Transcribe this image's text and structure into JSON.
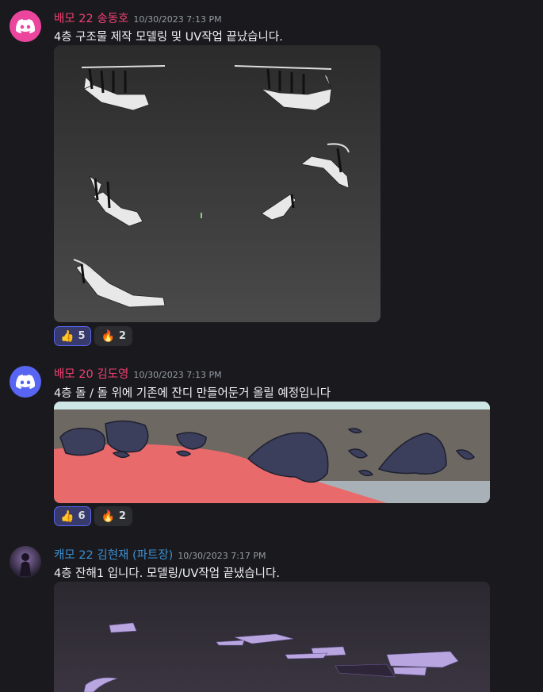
{
  "messages": [
    {
      "author": "배모 22 송동호",
      "author_color": "#f23f72",
      "avatar_color": "#eb459e",
      "timestamp": "10/30/2023 7:13 PM",
      "text": "4층 구조물 제작 모델링 및 UV작업 끝났습니다.",
      "reactions": [
        {
          "emoji": "👍",
          "count": "5",
          "me": true
        },
        {
          "emoji": "🔥",
          "count": "2",
          "me": false
        }
      ]
    },
    {
      "author": "배모 20 김도영",
      "author_color": "#f23f72",
      "avatar_color": "#5865f2",
      "timestamp": "10/30/2023 7:13 PM",
      "text": "4층 돌 / 돌 위에 기존에 잔디 만들어둔거 올릴 예정입니다",
      "reactions": [
        {
          "emoji": "👍",
          "count": "6",
          "me": true
        },
        {
          "emoji": "🔥",
          "count": "2",
          "me": false
        }
      ]
    },
    {
      "author": "캐모 22 김현재 (파트장)",
      "author_color": "#3b8fd1",
      "timestamp": "10/30/2023 7:17 PM",
      "text": "4층 잔해1 입니다. 모델링/UV작업 끝냈습니다."
    }
  ]
}
